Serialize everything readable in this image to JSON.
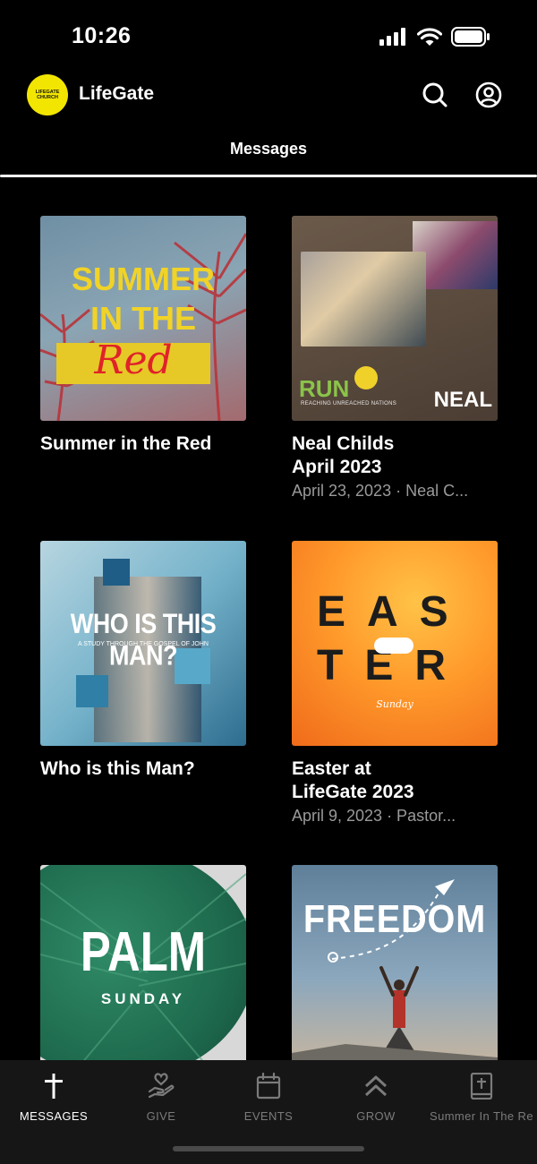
{
  "status": {
    "time": "10:26"
  },
  "header": {
    "logo_text_1": "LIFEGATE",
    "logo_text_2": "CHURCH",
    "title": "LifeGate",
    "search_icon": "search-icon",
    "profile_icon": "profile-icon"
  },
  "tabs": [
    {
      "label": "Messages"
    }
  ],
  "cards": [
    {
      "title": "Summer in the Red",
      "subtitle": "",
      "art_text_1": "SUMMER",
      "art_text_2": "IN THE",
      "art_text_3": "Red"
    },
    {
      "title": "Neal Childs\nApril 2023",
      "subtitle": "April 23, 2023 · Neal C...",
      "art_text_1": "RUN",
      "art_text_2": "REACHING UNREACHED NATIONS",
      "art_text_3": "NEAL"
    },
    {
      "title": "Who is this Man?",
      "subtitle": "",
      "art_text_1": "WHO IS THIS MAN?",
      "art_text_2": "A STUDY THROUGH THE GOSPEL OF JOHN"
    },
    {
      "title": "Easter at\nLifeGate 2023",
      "subtitle": "April 9, 2023 · Pastor...",
      "art_text_1": "EAS",
      "art_text_2": "TER",
      "art_text_3": "Sunday"
    },
    {
      "title": "",
      "subtitle": "",
      "art_text_1": "PALM",
      "art_text_2": "SUNDAY"
    },
    {
      "title": "",
      "subtitle": "",
      "art_text_1": "FREEDOM"
    }
  ],
  "nav": [
    {
      "label": "MESSAGES",
      "icon": "cross-icon",
      "active": true
    },
    {
      "label": "GIVE",
      "icon": "give-icon",
      "active": false
    },
    {
      "label": "EVENTS",
      "icon": "calendar-icon",
      "active": false
    },
    {
      "label": "GROW",
      "icon": "chevrons-up-icon",
      "active": false
    },
    {
      "label": "Summer In The Re",
      "icon": "bible-icon",
      "active": false
    }
  ],
  "colors": {
    "background": "#000000",
    "logo": "#f2e600",
    "nav_bg": "#161616",
    "muted": "#9a9a9a"
  }
}
